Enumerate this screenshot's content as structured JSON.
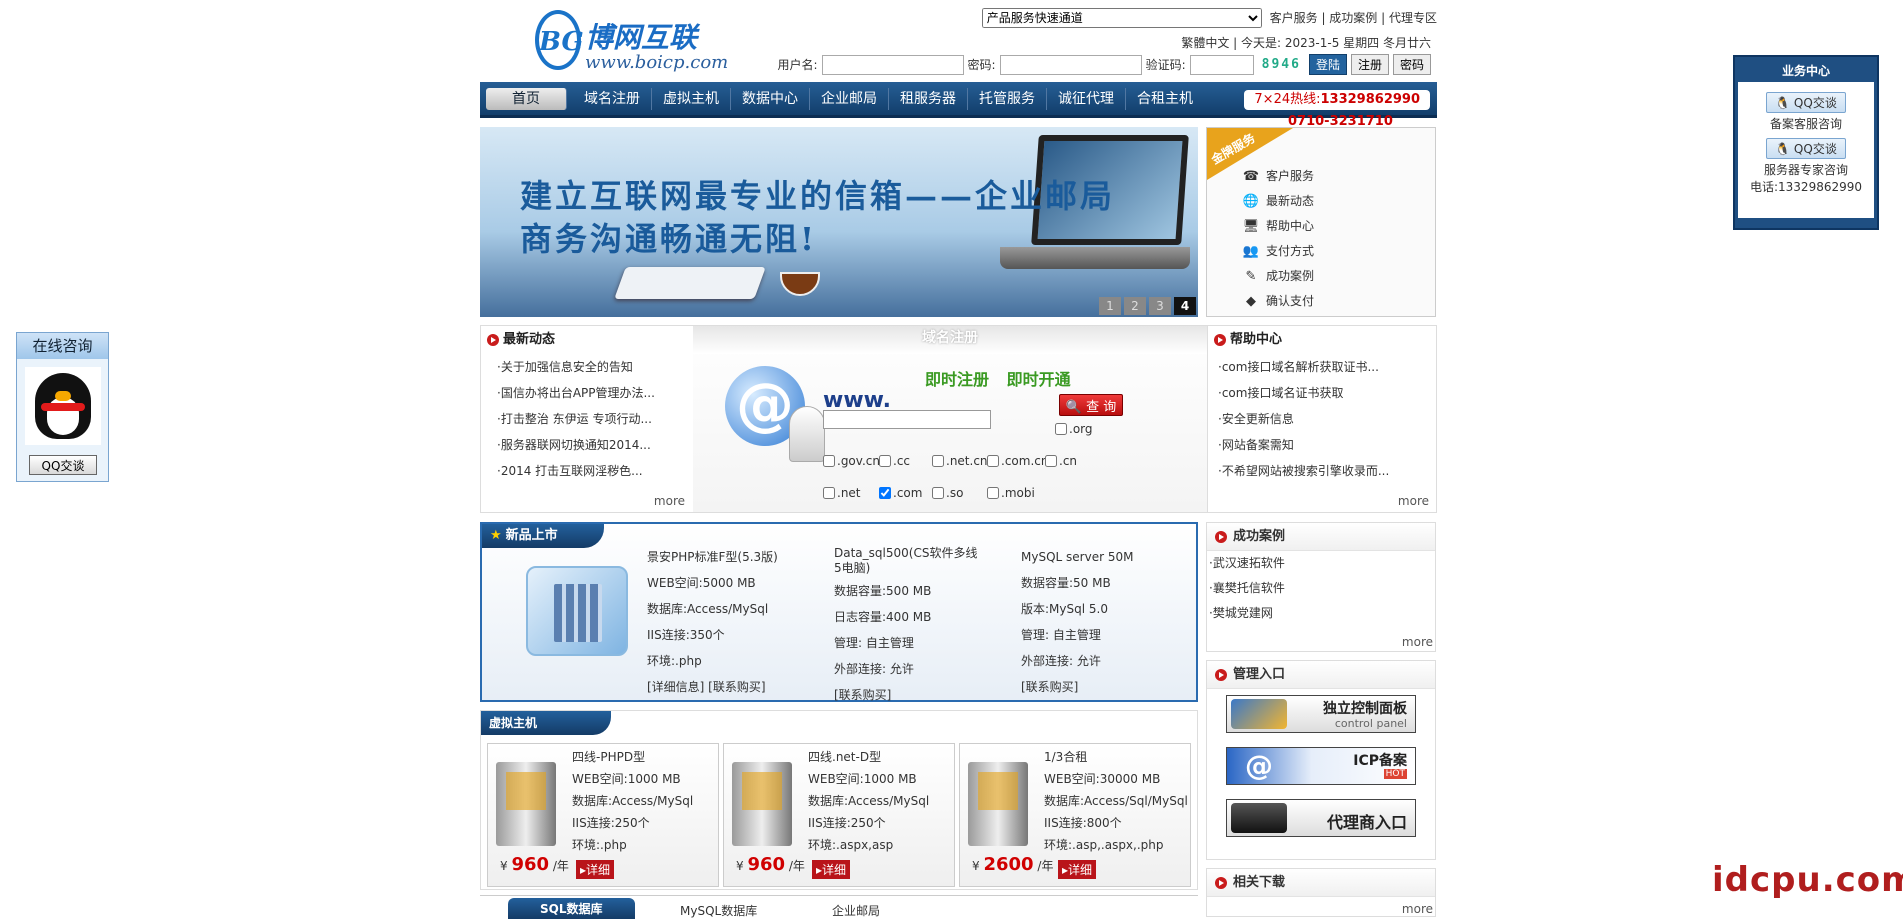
{
  "header": {
    "logo_cn": "博网互联",
    "logo_en": "www.boicp.com",
    "logo_mark": "BG",
    "quick_select": "产品服务快速通道",
    "top_links": [
      "客户服务",
      "成功案例",
      "代理专区"
    ],
    "date_line": "繁體中文 | 今天是: 2023-1-5 星期四 冬月廿六",
    "login": {
      "username_label": "用户名:",
      "password_label": "密码:",
      "captcha_label": "验证码:",
      "captcha": "8946",
      "login_btn": "登陆",
      "register_btn": "注册",
      "password_btn": "密码"
    }
  },
  "nav": {
    "items": [
      "首页",
      "域名注册",
      "虚拟主机",
      "数据中心",
      "企业邮局",
      "租服务器",
      "托管服务",
      "诚征代理",
      "合租主机"
    ],
    "hotline_label": "7×24热线:",
    "hotline": "13329862990",
    "hotline2": "0710-3231710"
  },
  "banner": {
    "line1": "建立互联网最专业的信箱——企业邮局",
    "line2": "商务沟通畅通无阻!",
    "pages": [
      "1",
      "2",
      "3",
      "4"
    ],
    "active_page": "4"
  },
  "gold": {
    "ribbon": "金牌服务",
    "items": [
      "客户服务",
      "最新动态",
      "帮助中心",
      "支付方式",
      "成功案例",
      "确认支付"
    ]
  },
  "news": {
    "title": "最新动态",
    "items": [
      "·关于加强信息安全的告知",
      "·国信办将出台APP管理办法...",
      "·打击整治 东伊运 专项行动...",
      "·服务器联网切换通知2014...",
      "·2014 打击互联网淫秽色..."
    ],
    "more": "more"
  },
  "domain": {
    "tab": "域名注册",
    "slogan": "即时注册 即时开通",
    "www": "www.",
    "query_btn": "查 询",
    "tlds": [
      ".org",
      ".gov.cn",
      ".cc",
      ".net.cn",
      ".com.cn",
      ".cn",
      ".net",
      ".com",
      ".so",
      ".mobi"
    ]
  },
  "help": {
    "title": "帮助中心",
    "items": [
      "·com接口域名解析获取证书...",
      "·com接口域名证书获取",
      "·安全更新信息",
      "·网站备案需知",
      "·不希望网站被搜索引擎收录而..."
    ],
    "more": "more"
  },
  "newprod": {
    "title": "新品上市",
    "col1": [
      "景安PHP标准F型(5.3版)",
      "WEB空间:5000 MB",
      "数据库:Access/MySql",
      "IIS连接:350个",
      "环境:.php",
      "[详细信息] [联系购买]"
    ],
    "col2": [
      "Data_sql500(CS软件多线5电脑)",
      "数据容量:500 MB",
      "日志容量:400 MB",
      "管理: 自主管理",
      "外部连接: 允许",
      "[联系购买]"
    ],
    "col3": [
      "MySQL server 50M",
      "数据容量:50 MB",
      "版本:MySql 5.0",
      "管理: 自主管理",
      "外部连接: 允许",
      "[联系购买]"
    ]
  },
  "cases": {
    "title": "成功案例",
    "items": [
      "·武汉速拓软件",
      "·襄樊托信软件",
      "·樊城党建网"
    ],
    "more": "more"
  },
  "manage": {
    "title": "管理入口",
    "buttons": [
      {
        "label": "独立控制面板",
        "sub": "control panel"
      },
      {
        "label": "ICP备案",
        "sub": "HOT"
      },
      {
        "label": "代理商入口",
        "sub": ""
      }
    ]
  },
  "downloads": {
    "title": "相关下载",
    "more": "more"
  },
  "vhost": {
    "title": "虚拟主机",
    "cards": [
      {
        "name": "四线-PHPD型",
        "web": "WEB空间:1000 MB",
        "db": "数据库:Access/MySql",
        "iis": "IIS连接:250个",
        "env": "环境:.php",
        "price": "960",
        "unit": "/年",
        "currency": "¥",
        "detail": "详细"
      },
      {
        "name": "四线.net-D型",
        "web": "WEB空间:1000 MB",
        "db": "数据库:Access/MySql",
        "iis": "IIS连接:250个",
        "env": "环境:.aspx,asp",
        "price": "960",
        "unit": "/年",
        "currency": "¥",
        "detail": "详细"
      },
      {
        "name": "1/3合租",
        "web": "WEB空间:30000 MB",
        "db": "数据库:Access/Sql/MySql",
        "iis": "IIS连接:800个",
        "env": "环境:.asp,.aspx,.php",
        "price": "2600",
        "unit": "/年",
        "currency": "¥",
        "detail": "详细"
      }
    ]
  },
  "sqlrow": {
    "tab": "SQL数据库",
    "items": [
      "MySQL数据库",
      "企业邮局"
    ]
  },
  "consult": {
    "title": "在线咨询",
    "btn": "QQ交谈"
  },
  "bizcenter": {
    "title": "业务中心",
    "qq1": "QQ交谈",
    "label1": "备案客服咨询",
    "qq2": "QQ交谈",
    "label2": "服务器专家咨询",
    "phone": "电话:13329862990"
  },
  "watermark": "idcpu.com"
}
